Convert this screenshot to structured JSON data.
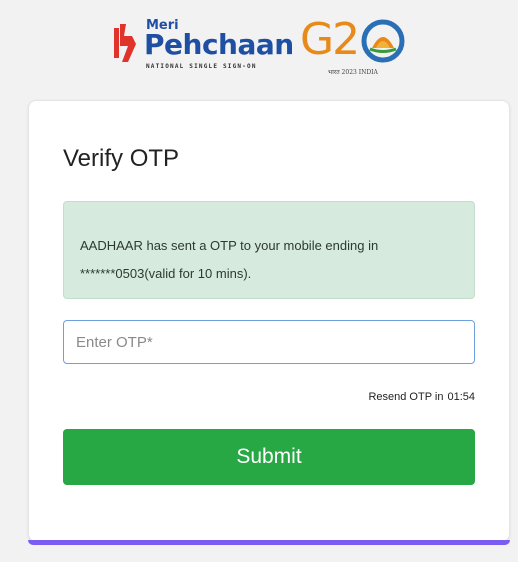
{
  "logo": {
    "small": "Meri",
    "name": "Pehchaan",
    "tagline": "NATIONAL SINGLE SIGN-ON"
  },
  "g20": {
    "text": "G2",
    "caption": "भारत 2023 INDIA"
  },
  "card": {
    "title": "Verify OTP",
    "message": "AADHAAR has sent a OTP to your mobile ending in *******0503(valid for 10 mins).",
    "otp_placeholder": "Enter OTP*",
    "resend_label": "Resend OTP in",
    "resend_timer": "01:54",
    "submit_label": "Submit"
  },
  "colors": {
    "accent_blue": "#1f4fa3",
    "submit_green": "#28a745",
    "alert_bg": "#d6eadd",
    "bottom_accent": "#7b5cf2",
    "g20_orange": "#e88a1a"
  }
}
